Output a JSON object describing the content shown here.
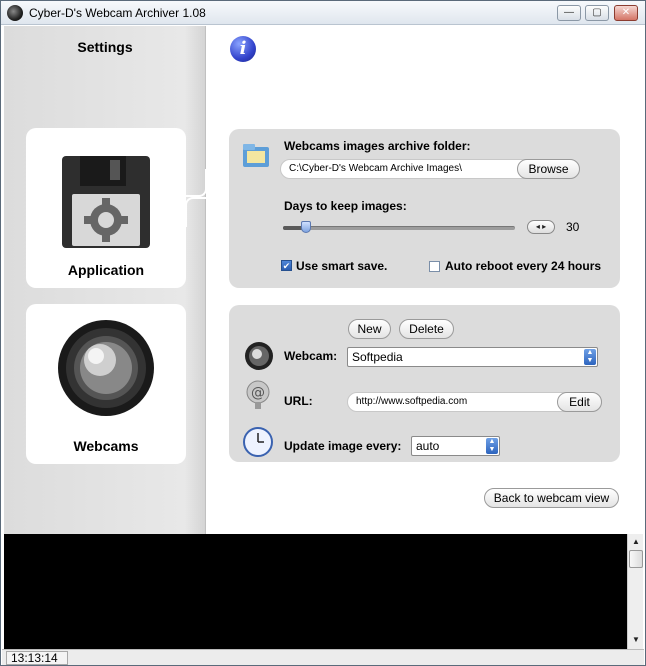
{
  "window": {
    "title": "Cyber-D's Webcam Archiver  1.08",
    "minimize": "—",
    "maximize": "▢",
    "close": "✕"
  },
  "sidebar": {
    "title": "Settings",
    "items": [
      {
        "label": "Application",
        "icon": "floppy-gear-icon"
      },
      {
        "label": "Webcams",
        "icon": "camera-lens-icon"
      }
    ]
  },
  "info": {
    "glyph": "i"
  },
  "application": {
    "folder_label": "Webcams images archive folder:",
    "folder_value": "C:\\Cyber-D's Webcam Archive Images\\",
    "browse_label": "Browse",
    "days_label": "Days to keep images:",
    "days_value": "30",
    "days_fraction": 0.1,
    "smart_save_label": "Use smart save.",
    "smart_save_checked": true,
    "auto_reboot_label": "Auto reboot every 24 hours",
    "auto_reboot_checked": false
  },
  "webcams": {
    "new_label": "New",
    "delete_label": "Delete",
    "webcam_label": "Webcam:",
    "webcam_value": "Softpedia",
    "url_label": "URL:",
    "url_value": "http://www.softpedia.com",
    "edit_label": "Edit",
    "update_label": "Update image every:",
    "update_value": "auto"
  },
  "back_button": "Back to webcam view",
  "status": {
    "time": "13:13:14"
  },
  "scrollbar": {
    "up": "▲",
    "down": "▼"
  },
  "stepper": "◂ ▸",
  "checkmark": "✔"
}
